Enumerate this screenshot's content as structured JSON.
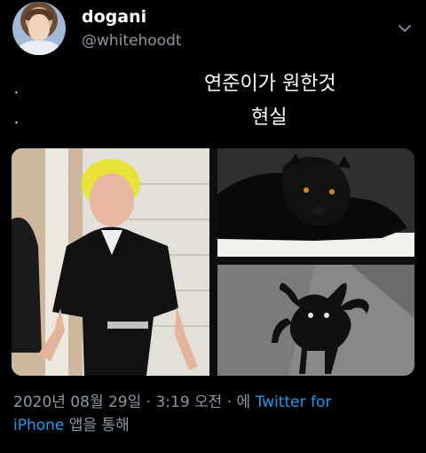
{
  "tweet": {
    "display_name": "dogani",
    "handle": "@whitehoodt",
    "bullet_1": ".",
    "bullet_2": ".",
    "line_1": "연준이가 원한것",
    "line_2": "현실",
    "footer_time": "2020년 08월 29일 · 3:19 오전 · 에 ",
    "footer_source_1": "Twitter for",
    "footer_source_2": "iPhone",
    "footer_suffix": " 앱을 통해"
  },
  "icons": {
    "more": "chevron-down-icon"
  },
  "colors": {
    "background": "#000000",
    "text": "#ffffff",
    "muted": "#8b98a5",
    "link": "#1d9bf0"
  }
}
